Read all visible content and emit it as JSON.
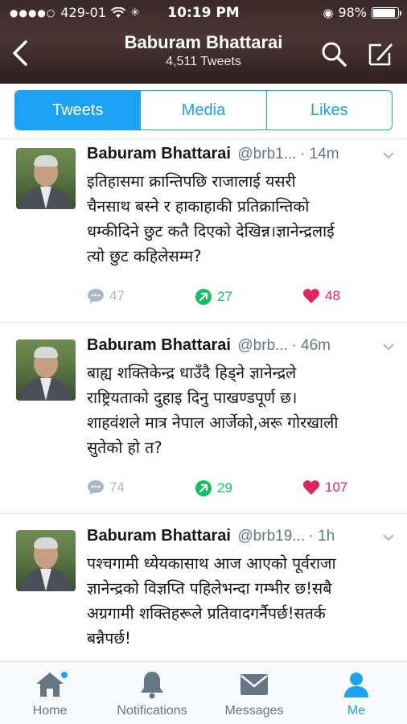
{
  "status_bar": {
    "carrier": "429-01",
    "time": "10:19 PM",
    "battery": "98%",
    "battery_level": 0.98
  },
  "header": {
    "title": "Baburam Bhattarai",
    "subtitle": "4,511 Tweets"
  },
  "tabs": [
    {
      "label": "Tweets",
      "active": true
    },
    {
      "label": "Media",
      "active": false
    },
    {
      "label": "Likes",
      "active": false
    }
  ],
  "tweets": [
    {
      "name": "Baburam Bhattarai",
      "handle": "@brb1...",
      "time": "· 14m",
      "lines": [
        "इतिहासमा क्रान्तिपछि राजालाई यसरी",
        "चैनसाथ बस्ने र हाकाहाकी प्रतिक्रान्तिको",
        "धम्कीदिने छुट कतै दिएको देखिन्न।ज्ञानेन्द्रलाई",
        "त्यो छुट कहिलेसम्म?"
      ],
      "replies": "47",
      "retweets": "27",
      "likes": "48"
    },
    {
      "name": "Baburam Bhattarai",
      "handle": "@brb...",
      "time": "· 46m",
      "lines": [
        "बाह्य शक्तिकेन्द्र धाउँदै हिड्ने ज्ञानेन्द्रले",
        "राष्ट्रियताको दुहाइ दिनु पाखण्डपूर्ण छ।",
        "शाहवंशले मात्र नेपाल आर्जेको,अरू गोरखाली",
        "सुतेको हो त?"
      ],
      "replies": "74",
      "retweets": "29",
      "likes": "107"
    },
    {
      "name": "Baburam Bhattarai",
      "handle": "@brb19...",
      "time": "· 1h",
      "lines": [
        "पश्चगामी ध्येयकासाथ आज आएको पूर्वराजा",
        "ज्ञानेन्द्रको विज्ञप्ति पहिलेभन्दा गम्भीर छ!सबै",
        "अग्रगामी शक्तिहरूले प्रतिवादगर्नैपर्छ!सतर्क",
        "बन्नैपर्छ!"
      ]
    }
  ],
  "nav": [
    {
      "label": "Home",
      "icon": "home-icon"
    },
    {
      "label": "Notifications",
      "icon": "bell-icon"
    },
    {
      "label": "Messages",
      "icon": "envelope-icon"
    },
    {
      "label": "Me",
      "icon": "person-icon",
      "active": true
    }
  ],
  "colors": {
    "accent": "#1da1f2",
    "retweet": "#17bf63",
    "like": "#e0245e",
    "muted": "#657786"
  }
}
